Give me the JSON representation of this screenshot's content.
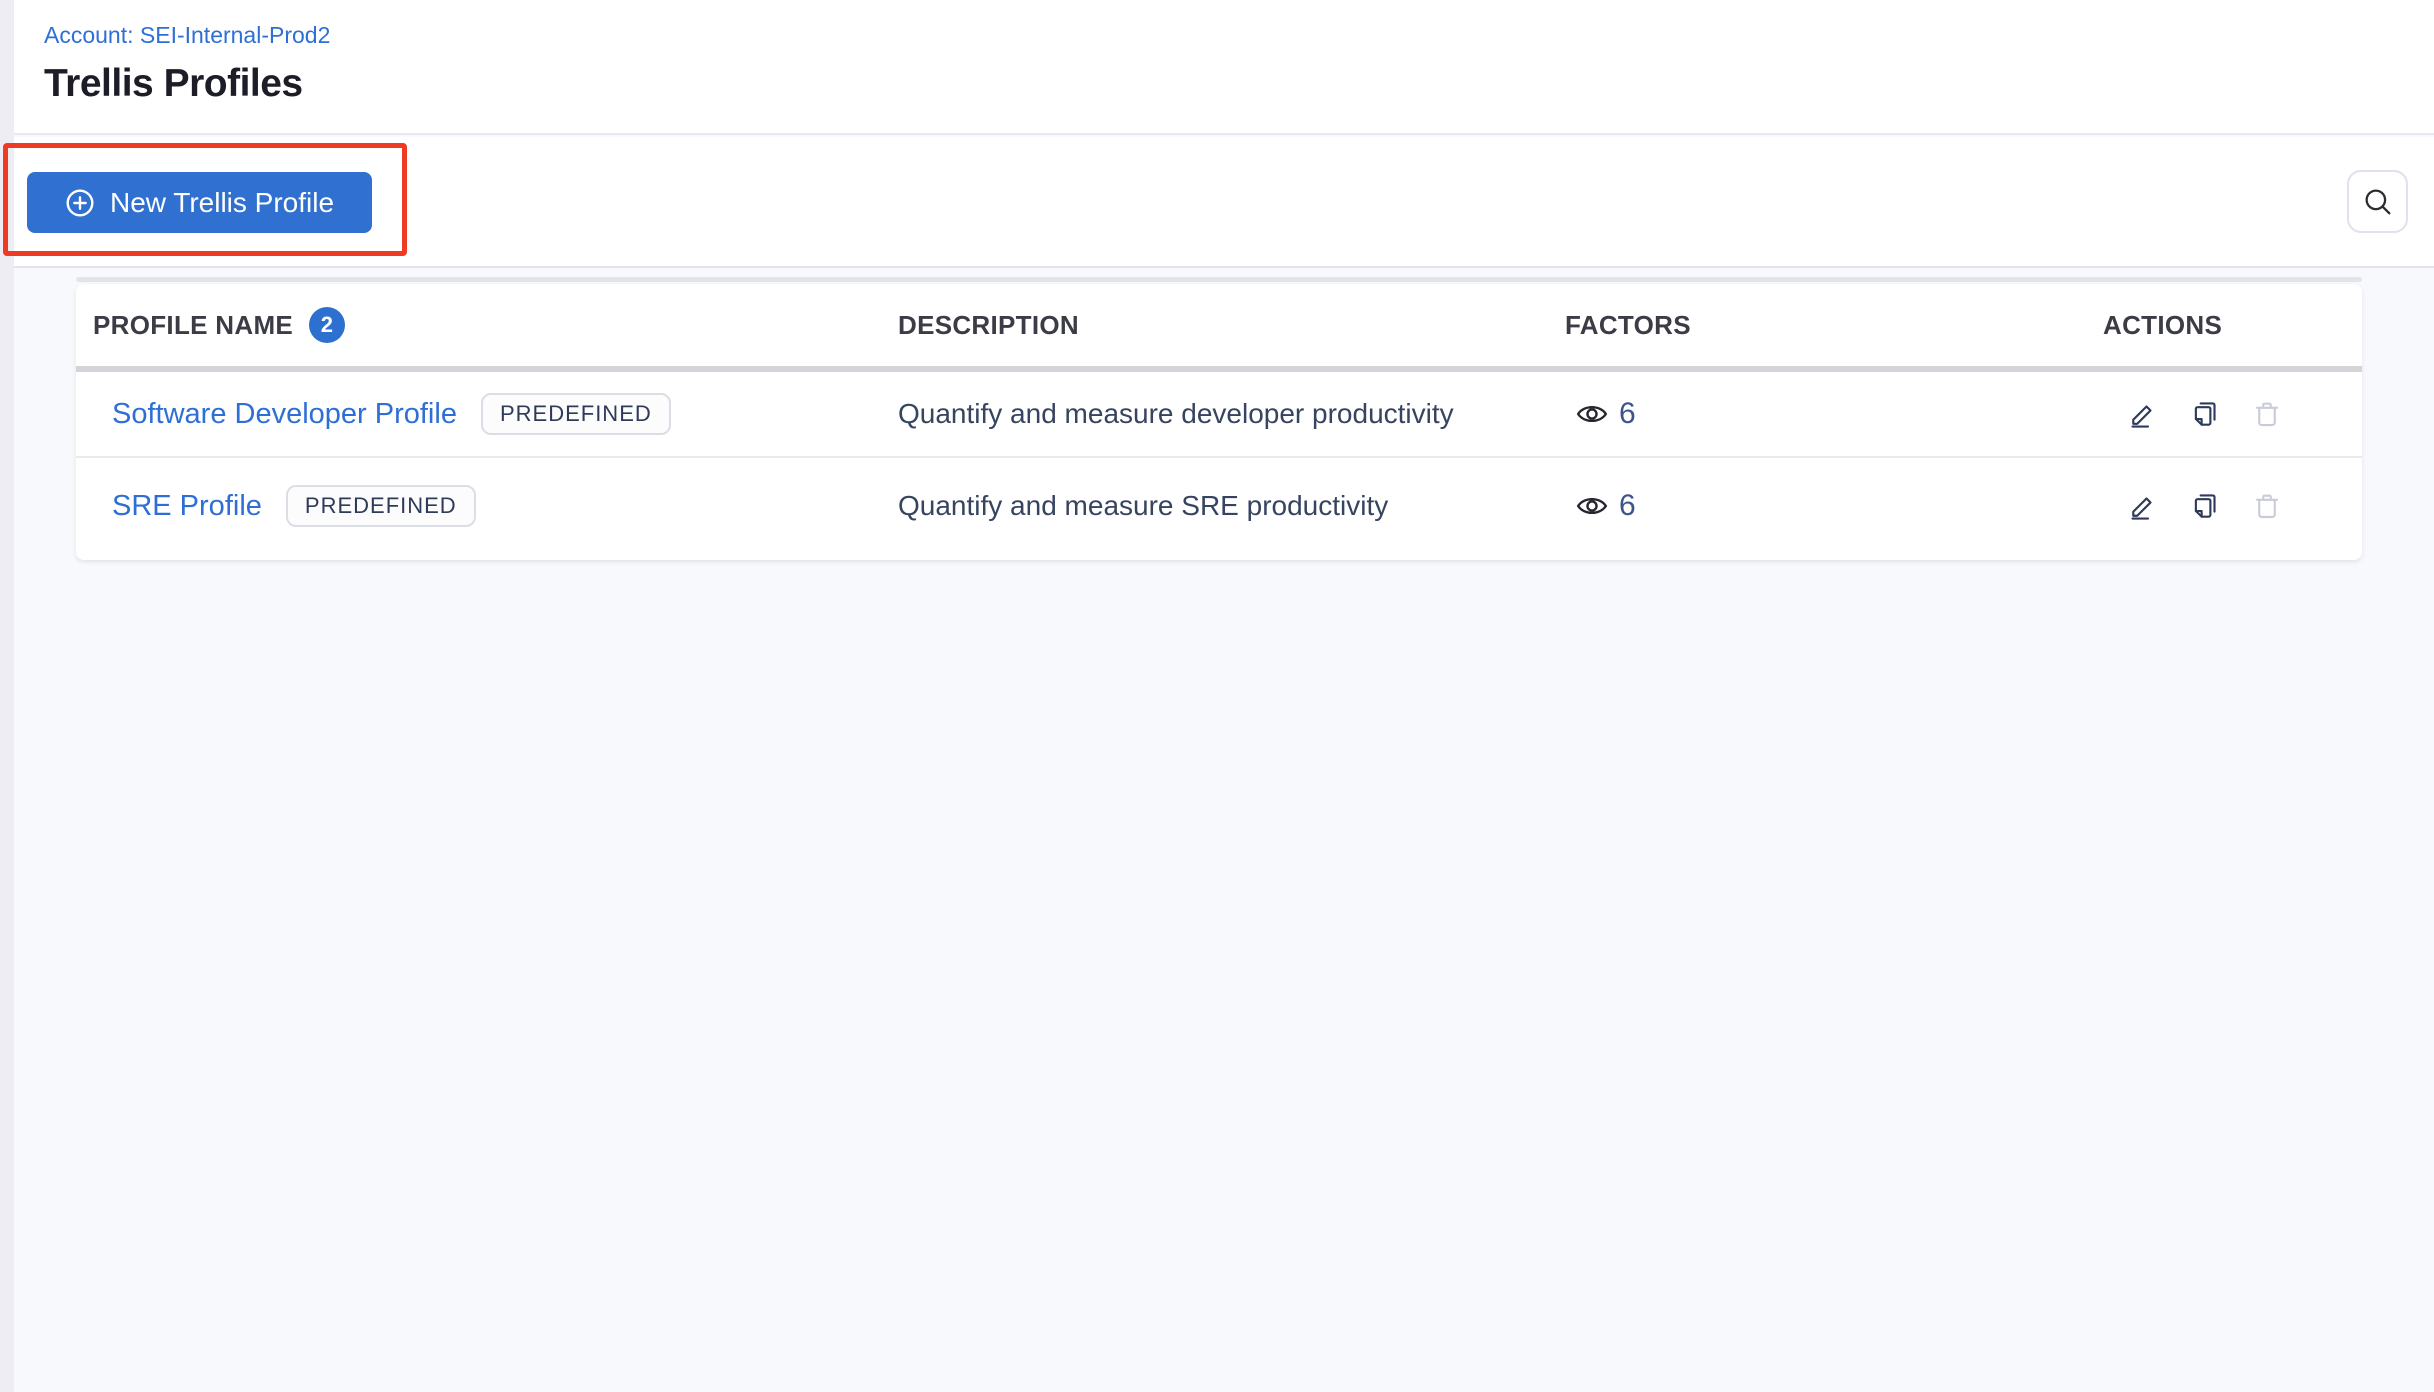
{
  "page": {
    "account_label": "Account: SEI-Internal-Prod2",
    "title": "Trellis Profiles"
  },
  "toolbar": {
    "new_profile_button_label": "New Trellis Profile"
  },
  "table": {
    "headers": {
      "name": "PROFILE NAME",
      "count": "2",
      "description": "DESCRIPTION",
      "factors": "FACTORS",
      "actions": "ACTIONS"
    },
    "rows": [
      {
        "name": "Software Developer Profile",
        "tag": "PREDEFINED",
        "description": "Quantify and measure developer productivity",
        "factors": "6"
      },
      {
        "name": "SRE Profile",
        "tag": "PREDEFINED",
        "description": "Quantify and measure SRE productivity",
        "factors": "6"
      }
    ]
  },
  "icons": {
    "plus_circle": "plus-circle-icon",
    "search": "search-icon",
    "eye": "eye-icon",
    "edit": "edit-icon",
    "copy": "copy-icon",
    "delete": "delete-icon"
  },
  "colors": {
    "primary_blue": "#2f70d1",
    "link_blue": "#2e6fd6",
    "annotation_red": "#ee3b24",
    "badge_blue": "#2e70d0",
    "text_dark": "#1d1d27",
    "text_navy": "#374460",
    "disabled_gray": "#c9ccd6",
    "page_background": "#f7f9fc"
  }
}
